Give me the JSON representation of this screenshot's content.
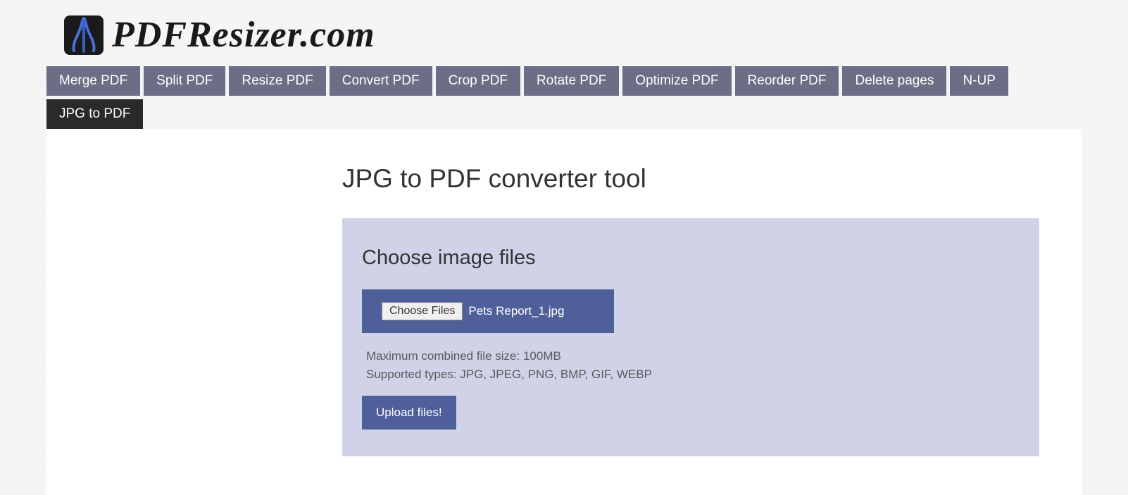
{
  "header": {
    "logo_text": "PDFResizer.com"
  },
  "nav": {
    "items": [
      {
        "label": "Merge PDF",
        "active": false
      },
      {
        "label": "Split PDF",
        "active": false
      },
      {
        "label": "Resize PDF",
        "active": false
      },
      {
        "label": "Convert PDF",
        "active": false
      },
      {
        "label": "Crop PDF",
        "active": false
      },
      {
        "label": "Rotate PDF",
        "active": false
      },
      {
        "label": "Optimize PDF",
        "active": false
      },
      {
        "label": "Reorder PDF",
        "active": false
      },
      {
        "label": "Delete pages",
        "active": false
      },
      {
        "label": "N-UP",
        "active": false
      },
      {
        "label": "JPG to PDF",
        "active": true
      }
    ]
  },
  "main": {
    "title": "JPG to PDF converter tool",
    "panel": {
      "heading": "Choose image files",
      "choose_button": "Choose Files",
      "selected_file": "Pets Report_1.jpg",
      "max_size_text": "Maximum combined file size: 100MB",
      "supported_text": "Supported types: JPG, JPEG, PNG, BMP, GIF, WEBP",
      "upload_button": "Upload files!"
    }
  }
}
